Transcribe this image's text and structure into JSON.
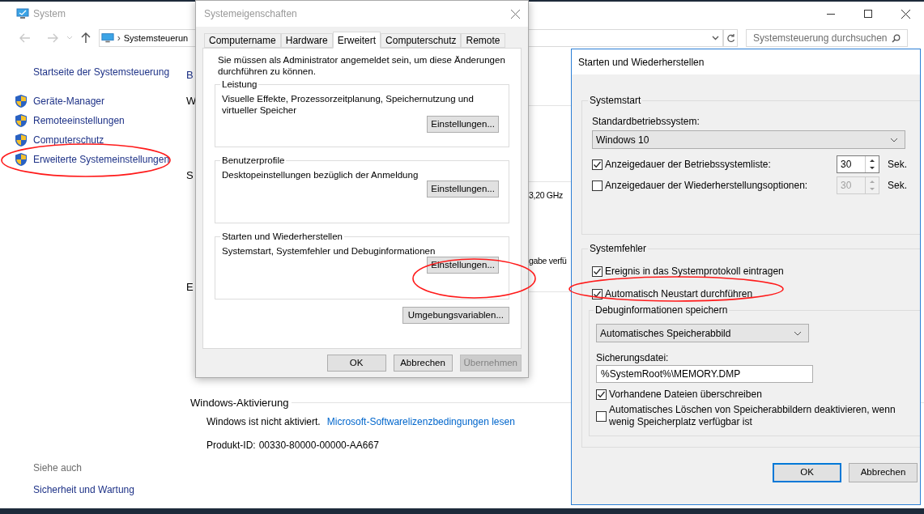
{
  "main_window": {
    "title": "System",
    "breadcrumb_separator": "›",
    "breadcrumb": "Systemsteuerun",
    "search": {
      "placeholder": "Systemsteuerung durchsuchen"
    },
    "sidebar": {
      "home_link": "Startseite der Systemsteuerung",
      "items": [
        {
          "label": "Geräte-Manager"
        },
        {
          "label": "Remoteeinstellungen"
        },
        {
          "label": "Computerschutz"
        },
        {
          "label": "Erweiterte Systemeinstellungen"
        }
      ],
      "see_also": {
        "heading": "Siehe auch",
        "links": [
          "Sicherheit und Wartung"
        ]
      }
    },
    "content_fragments": [
      "B",
      "W",
      "S",
      "E"
    ],
    "right_fragments": [
      "3,20 GHz",
      "gabe verfü"
    ],
    "activation": {
      "heading": "Windows-Aktivierung",
      "status": "Windows ist nicht aktiviert.",
      "link": "Microsoft-Softwarelizenzbedingungen lesen",
      "product_id_label": "Produkt-ID:",
      "product_id": "00330-80000-00000-AA667"
    }
  },
  "system_properties": {
    "title": "Systemeigenschaften",
    "tabs": [
      {
        "label": "Computername",
        "selected": false
      },
      {
        "label": "Hardware",
        "selected": false
      },
      {
        "label": "Erweitert",
        "selected": true
      },
      {
        "label": "Computerschutz",
        "selected": false
      },
      {
        "label": "Remote",
        "selected": false
      }
    ],
    "notice": "Sie müssen als Administrator angemeldet sein, um diese Änderungen durchführen zu können.",
    "groups": [
      {
        "title": "Leistung",
        "description": "Visuelle Effekte, Prozessorzeitplanung, Speichernutzung und virtueller Speicher",
        "button": "Einstellungen..."
      },
      {
        "title": "Benutzerprofile",
        "description": "Desktopeinstellungen bezüglich der Anmeldung",
        "button": "Einstellungen..."
      },
      {
        "title": "Starten und Wiederherstellen",
        "description": "Systemstart, Systemfehler und Debuginformationen",
        "button": "Einstellungen..."
      }
    ],
    "env_button": "Umgebungsvariablen...",
    "buttons": [
      {
        "label": "OK",
        "disabled": false
      },
      {
        "label": "Abbrechen",
        "disabled": false
      },
      {
        "label": "Übernehmen",
        "disabled": true
      }
    ]
  },
  "startup_recovery": {
    "title": "Starten und Wiederherstellen",
    "systemstart": {
      "title": "Systemstart",
      "os_label": "Standardbetriebssystem:",
      "os_value": "Windows 10",
      "timeouts": [
        {
          "label": "Anzeigedauer der Betriebssystemliste:",
          "checked": true,
          "value": "30",
          "unit": "Sek."
        },
        {
          "label": "Anzeigedauer der Wiederherstellungsoptionen:",
          "checked": false,
          "value": "30",
          "unit": "Sek."
        }
      ]
    },
    "system_failure": {
      "title": "Systemfehler",
      "options": [
        {
          "label": "Ereignis in das Systemprotokoll eintragen",
          "checked": true
        },
        {
          "label": "Automatisch Neustart durchführen",
          "checked": true
        }
      ],
      "debug": {
        "title": "Debuginformationen speichern",
        "type": "Automatisches Speicherabbild",
        "file_label": "Sicherungsdatei:",
        "file_value": "%SystemRoot%\\MEMORY.DMP",
        "options": [
          {
            "label": "Vorhandene Dateien überschreiben",
            "checked": true
          },
          {
            "label": "Automatisches Löschen von Speicherabbildern deaktivieren, wenn wenig Speicherplatz verfügbar ist",
            "checked": false
          }
        ]
      }
    },
    "buttons": [
      {
        "label": "OK",
        "default": true
      },
      {
        "label": "Abbrechen",
        "default": false
      }
    ]
  }
}
